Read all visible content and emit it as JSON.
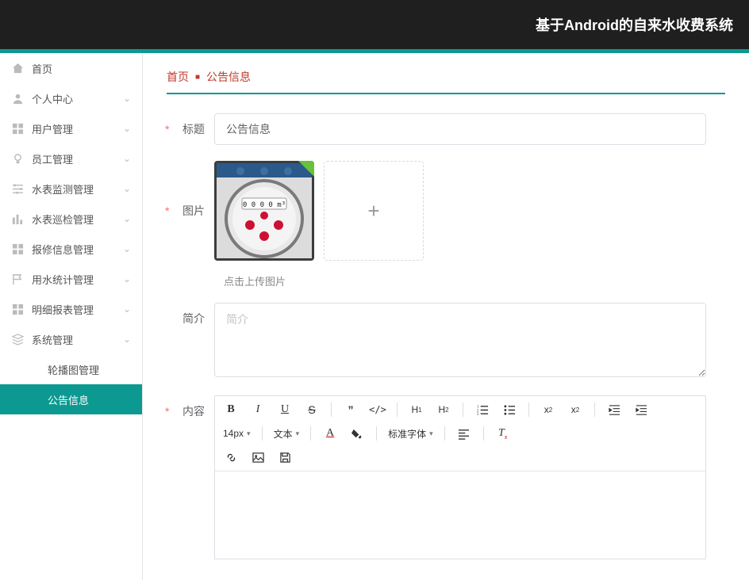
{
  "header": {
    "title": "基于Android的自来水收费系统"
  },
  "sidebar": {
    "items": [
      {
        "label": "首页",
        "icon": "home"
      },
      {
        "label": "个人中心",
        "icon": "user",
        "expandable": true
      },
      {
        "label": "用户管理",
        "icon": "grid",
        "expandable": true
      },
      {
        "label": "员工管理",
        "icon": "bulb",
        "expandable": true
      },
      {
        "label": "水表监测管理",
        "icon": "sliders",
        "expandable": true
      },
      {
        "label": "水表巡检管理",
        "icon": "bars",
        "expandable": true
      },
      {
        "label": "报修信息管理",
        "icon": "grid",
        "expandable": true
      },
      {
        "label": "用水统计管理",
        "icon": "flag",
        "expandable": true
      },
      {
        "label": "明细报表管理",
        "icon": "grid",
        "expandable": true
      },
      {
        "label": "系统管理",
        "icon": "stack",
        "expandable": true
      }
    ],
    "subs": [
      {
        "label": "轮播图管理"
      },
      {
        "label": "公告信息",
        "active": true
      }
    ]
  },
  "breadcrumb": {
    "crumb0": "首页",
    "crumb1": "公告信息"
  },
  "form": {
    "title": {
      "label": "标题",
      "value": "公告信息"
    },
    "image": {
      "label": "图片",
      "hint": "点击上传图片"
    },
    "summary": {
      "label": "简介",
      "placeholder": "简介",
      "value": ""
    },
    "content": {
      "label": "内容"
    }
  },
  "editor": {
    "font_size": "14px",
    "block_type": "文本",
    "font_family": "标准字体"
  }
}
